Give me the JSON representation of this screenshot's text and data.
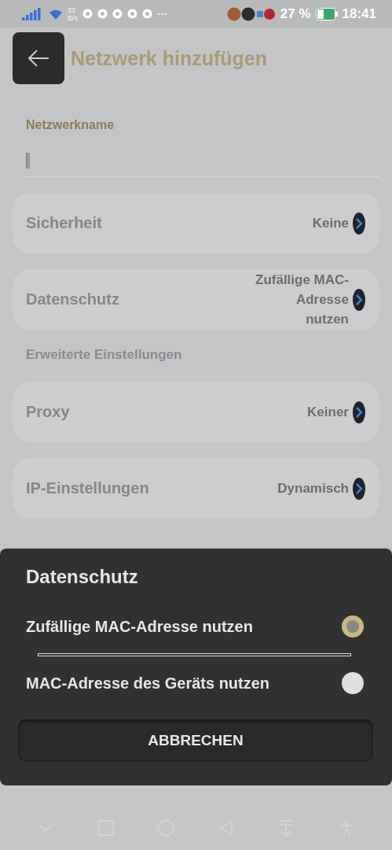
{
  "status_bar": {
    "speed_value": "32",
    "speed_unit": "B/s",
    "more": "···",
    "battery": "27 %",
    "time": "18:41"
  },
  "header": {
    "title": "Netzwerk hinzufügen"
  },
  "network_name": {
    "label": "Netzwerkname"
  },
  "settings": [
    {
      "label": "Sicherheit",
      "value": "Keine"
    },
    {
      "label": "Datenschutz",
      "value": "Zufällige MAC-Adresse nutzen"
    }
  ],
  "advanced": {
    "heading": "Erweiterte Einstellungen",
    "settings": [
      {
        "label": "Proxy",
        "value": "Keiner"
      },
      {
        "label": "IP-Einstellungen",
        "value": "Dynamisch"
      }
    ]
  },
  "dialog": {
    "title": "Datenschutz",
    "options": [
      {
        "label": "Zufällige MAC-Adresse nutzen",
        "selected": true
      },
      {
        "label": "MAC-Adresse des Geräts nutzen",
        "selected": false
      }
    ],
    "cancel": "ABBRECHEN"
  }
}
